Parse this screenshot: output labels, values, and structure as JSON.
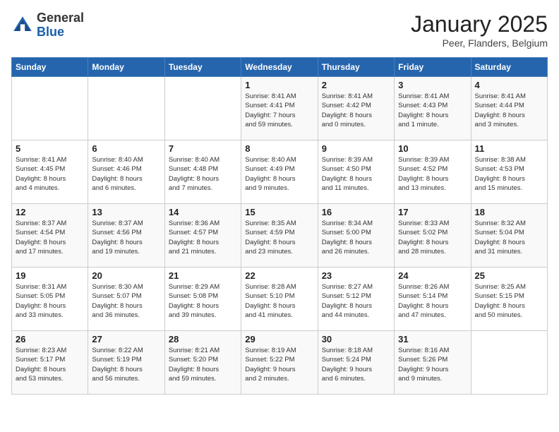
{
  "header": {
    "logo_line1": "General",
    "logo_line2": "Blue",
    "calendar_title": "January 2025",
    "calendar_subtitle": "Peer, Flanders, Belgium"
  },
  "weekdays": [
    "Sunday",
    "Monday",
    "Tuesday",
    "Wednesday",
    "Thursday",
    "Friday",
    "Saturday"
  ],
  "weeks": [
    [
      {
        "day": "",
        "info": ""
      },
      {
        "day": "",
        "info": ""
      },
      {
        "day": "",
        "info": ""
      },
      {
        "day": "1",
        "info": "Sunrise: 8:41 AM\nSunset: 4:41 PM\nDaylight: 7 hours\nand 59 minutes."
      },
      {
        "day": "2",
        "info": "Sunrise: 8:41 AM\nSunset: 4:42 PM\nDaylight: 8 hours\nand 0 minutes."
      },
      {
        "day": "3",
        "info": "Sunrise: 8:41 AM\nSunset: 4:43 PM\nDaylight: 8 hours\nand 1 minute."
      },
      {
        "day": "4",
        "info": "Sunrise: 8:41 AM\nSunset: 4:44 PM\nDaylight: 8 hours\nand 3 minutes."
      }
    ],
    [
      {
        "day": "5",
        "info": "Sunrise: 8:41 AM\nSunset: 4:45 PM\nDaylight: 8 hours\nand 4 minutes."
      },
      {
        "day": "6",
        "info": "Sunrise: 8:40 AM\nSunset: 4:46 PM\nDaylight: 8 hours\nand 6 minutes."
      },
      {
        "day": "7",
        "info": "Sunrise: 8:40 AM\nSunset: 4:48 PM\nDaylight: 8 hours\nand 7 minutes."
      },
      {
        "day": "8",
        "info": "Sunrise: 8:40 AM\nSunset: 4:49 PM\nDaylight: 8 hours\nand 9 minutes."
      },
      {
        "day": "9",
        "info": "Sunrise: 8:39 AM\nSunset: 4:50 PM\nDaylight: 8 hours\nand 11 minutes."
      },
      {
        "day": "10",
        "info": "Sunrise: 8:39 AM\nSunset: 4:52 PM\nDaylight: 8 hours\nand 13 minutes."
      },
      {
        "day": "11",
        "info": "Sunrise: 8:38 AM\nSunset: 4:53 PM\nDaylight: 8 hours\nand 15 minutes."
      }
    ],
    [
      {
        "day": "12",
        "info": "Sunrise: 8:37 AM\nSunset: 4:54 PM\nDaylight: 8 hours\nand 17 minutes."
      },
      {
        "day": "13",
        "info": "Sunrise: 8:37 AM\nSunset: 4:56 PM\nDaylight: 8 hours\nand 19 minutes."
      },
      {
        "day": "14",
        "info": "Sunrise: 8:36 AM\nSunset: 4:57 PM\nDaylight: 8 hours\nand 21 minutes."
      },
      {
        "day": "15",
        "info": "Sunrise: 8:35 AM\nSunset: 4:59 PM\nDaylight: 8 hours\nand 23 minutes."
      },
      {
        "day": "16",
        "info": "Sunrise: 8:34 AM\nSunset: 5:00 PM\nDaylight: 8 hours\nand 26 minutes."
      },
      {
        "day": "17",
        "info": "Sunrise: 8:33 AM\nSunset: 5:02 PM\nDaylight: 8 hours\nand 28 minutes."
      },
      {
        "day": "18",
        "info": "Sunrise: 8:32 AM\nSunset: 5:04 PM\nDaylight: 8 hours\nand 31 minutes."
      }
    ],
    [
      {
        "day": "19",
        "info": "Sunrise: 8:31 AM\nSunset: 5:05 PM\nDaylight: 8 hours\nand 33 minutes."
      },
      {
        "day": "20",
        "info": "Sunrise: 8:30 AM\nSunset: 5:07 PM\nDaylight: 8 hours\nand 36 minutes."
      },
      {
        "day": "21",
        "info": "Sunrise: 8:29 AM\nSunset: 5:08 PM\nDaylight: 8 hours\nand 39 minutes."
      },
      {
        "day": "22",
        "info": "Sunrise: 8:28 AM\nSunset: 5:10 PM\nDaylight: 8 hours\nand 41 minutes."
      },
      {
        "day": "23",
        "info": "Sunrise: 8:27 AM\nSunset: 5:12 PM\nDaylight: 8 hours\nand 44 minutes."
      },
      {
        "day": "24",
        "info": "Sunrise: 8:26 AM\nSunset: 5:14 PM\nDaylight: 8 hours\nand 47 minutes."
      },
      {
        "day": "25",
        "info": "Sunrise: 8:25 AM\nSunset: 5:15 PM\nDaylight: 8 hours\nand 50 minutes."
      }
    ],
    [
      {
        "day": "26",
        "info": "Sunrise: 8:23 AM\nSunset: 5:17 PM\nDaylight: 8 hours\nand 53 minutes."
      },
      {
        "day": "27",
        "info": "Sunrise: 8:22 AM\nSunset: 5:19 PM\nDaylight: 8 hours\nand 56 minutes."
      },
      {
        "day": "28",
        "info": "Sunrise: 8:21 AM\nSunset: 5:20 PM\nDaylight: 8 hours\nand 59 minutes."
      },
      {
        "day": "29",
        "info": "Sunrise: 8:19 AM\nSunset: 5:22 PM\nDaylight: 9 hours\nand 2 minutes."
      },
      {
        "day": "30",
        "info": "Sunrise: 8:18 AM\nSunset: 5:24 PM\nDaylight: 9 hours\nand 6 minutes."
      },
      {
        "day": "31",
        "info": "Sunrise: 8:16 AM\nSunset: 5:26 PM\nDaylight: 9 hours\nand 9 minutes."
      },
      {
        "day": "",
        "info": ""
      }
    ]
  ]
}
